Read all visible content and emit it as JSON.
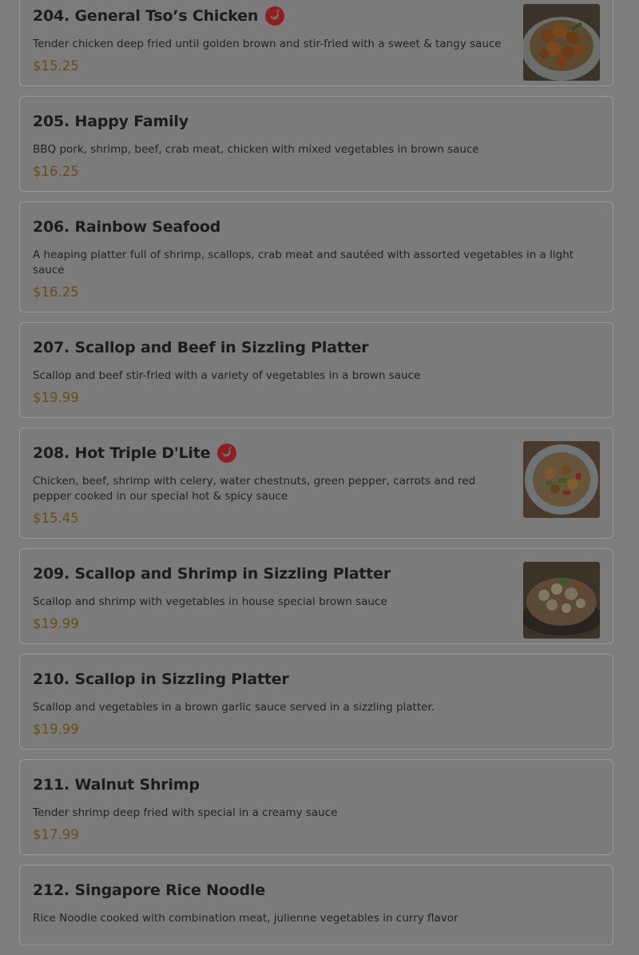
{
  "menu": {
    "items": [
      {
        "title": "204. General Tso’s Chicken",
        "spicy": true,
        "description": "Tender chicken deep fried until golden brown and stir-fried with a sweet & tangy sauce",
        "price": "$15.25",
        "photo": "general-tso-chicken-photo"
      },
      {
        "title": "205. Happy Family",
        "spicy": false,
        "description": "BBQ pork, shrimp, beef, crab meat, chicken with mixed vegetables in brown sauce",
        "price": "$16.25"
      },
      {
        "title": "206. Rainbow Seafood",
        "spicy": false,
        "description": "A heaping platter full of shrimp, scallops, crab meat and sautéed with assorted vegetables in a light sauce",
        "price": "$16.25"
      },
      {
        "title": "207. Scallop and Beef in Sizzling Platter",
        "spicy": false,
        "description": "Scallop and beef stir-fried with a variety of vegetables in a brown sauce",
        "price": "$19.99"
      },
      {
        "title": "208. Hot Triple D'Lite",
        "spicy": true,
        "description": "Chicken, beef, shrimp with celery, water chestnuts, green pepper, carrots and red pepper cooked in our special hot & spicy sauce",
        "price": "$15.45",
        "photo": "hot-triple-dlite-photo"
      },
      {
        "title": "209. Scallop and Shrimp in Sizzling Platter",
        "spicy": false,
        "description": "Scallop and shrimp with vegetables in house special brown sauce",
        "price": "$19.99",
        "photo": "scallop-shrimp-sizzling-photo"
      },
      {
        "title": "210. Scallop in Sizzling Platter",
        "spicy": false,
        "description": "Scallop and vegetables in a brown garlic sauce served in a sizzling platter.",
        "price": "$19.99"
      },
      {
        "title": "211. Walnut Shrimp",
        "spicy": false,
        "description": "Tender shrimp deep fried with special in a creamy sauce",
        "price": "$17.99"
      },
      {
        "title": "212. Singapore Rice Noodle",
        "spicy": false,
        "description": "Rice Noodle cooked with combination meat, julienne vegetables in curry flavor",
        "price": ""
      }
    ]
  },
  "colors": {
    "overlay_background": "#7d7d7d",
    "card_border": "#989898",
    "price": "#6b4d14",
    "spicy_badge": "#8f1e22"
  }
}
